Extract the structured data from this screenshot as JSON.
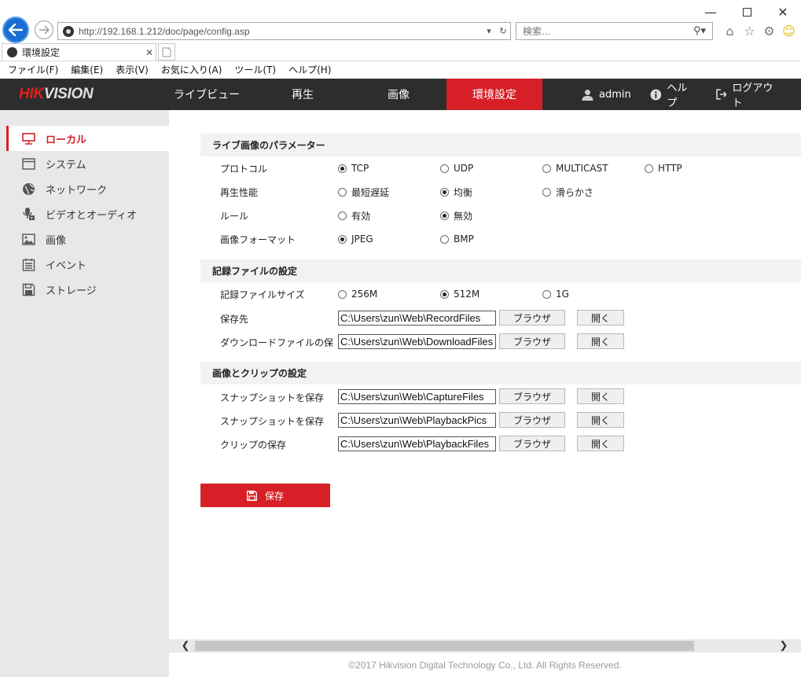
{
  "browser": {
    "address_url": "http://192.168.1.212/doc/page/config.asp",
    "search_placeholder": "検索...",
    "tab_title": "環境設定",
    "menu": [
      "ファイル(F)",
      "編集(E)",
      "表示(V)",
      "お気に入り(A)",
      "ツール(T)",
      "ヘルプ(H)"
    ]
  },
  "header": {
    "logo_red": "HIK",
    "logo_rest": "VISION",
    "nav": [
      "ライブビュー",
      "再生",
      "画像",
      "環境設定"
    ],
    "active_nav": 3,
    "user": "admin",
    "help": "ヘルプ",
    "logout": "ログアウト"
  },
  "sidebar": {
    "items": [
      "ローカル",
      "システム",
      "ネットワーク",
      "ビデオとオーディオ",
      "画像",
      "イベント",
      "ストレージ"
    ],
    "active": 0
  },
  "live_params": {
    "title": "ライブ画像のパラメーター",
    "protocol": {
      "label": "プロトコル",
      "options": [
        "TCP",
        "UDP",
        "MULTICAST",
        "HTTP"
      ],
      "selected": 0
    },
    "performance": {
      "label": "再生性能",
      "options": [
        "最短遅延",
        "均衡",
        "滑らかさ"
      ],
      "selected": 1
    },
    "rule": {
      "label": "ルール",
      "options": [
        "有効",
        "無効"
      ],
      "selected": 1
    },
    "image_format": {
      "label": "画像フォーマット",
      "options": [
        "JPEG",
        "BMP"
      ],
      "selected": 0
    }
  },
  "record_settings": {
    "title": "記録ファイルの設定",
    "file_size": {
      "label": "記録ファイルサイズ",
      "options": [
        "256M",
        "512M",
        "1G"
      ],
      "selected": 1
    },
    "save_to": {
      "label": "保存先",
      "path": "C:\\Users\\zun\\Web\\RecordFiles"
    },
    "download_to": {
      "label": "ダウンロードファイルの保存先",
      "path": "C:\\Users\\zun\\Web\\DownloadFiles"
    }
  },
  "clip_settings": {
    "title": "画像とクリップの設定",
    "snapshot_live": {
      "label": "スナップショットを保存",
      "path": "C:\\Users\\zun\\Web\\CaptureFiles"
    },
    "snapshot_playback": {
      "label": "スナップショットを保存",
      "path": "C:\\Users\\zun\\Web\\PlaybackPics"
    },
    "clips": {
      "label": "クリップの保存",
      "path": "C:\\Users\\zun\\Web\\PlaybackFiles"
    }
  },
  "buttons": {
    "browse": "ブラウザ",
    "open": "開く",
    "save": "保存"
  },
  "footer": "©2017 Hikvision Digital Technology Co., Ltd. All Rights Reserved.",
  "colors": {
    "accent": "#d71f27",
    "header_bg": "#2d2d2d",
    "sidebar_bg": "#e8e8e8"
  }
}
